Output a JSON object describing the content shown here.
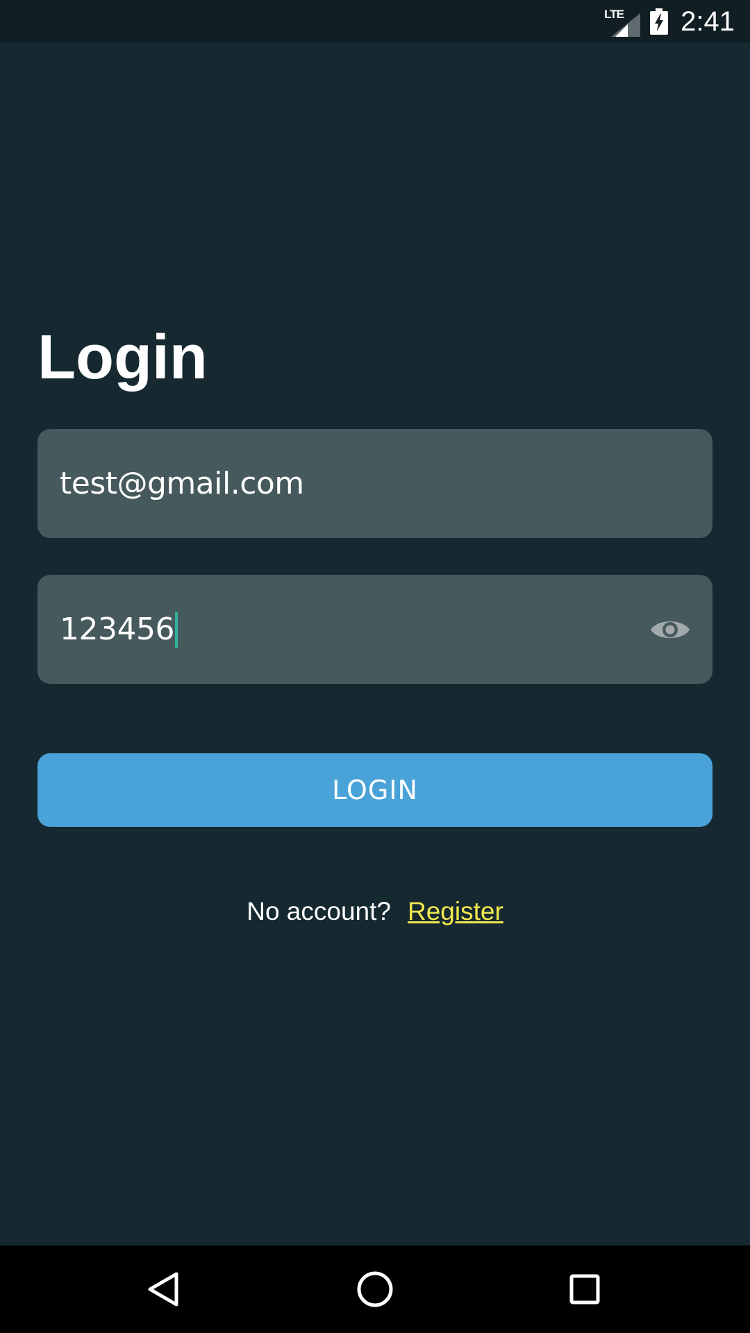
{
  "status_bar": {
    "network": "LTE",
    "time": "2:41",
    "icons": [
      "lte-signal-icon",
      "battery-charging-icon"
    ]
  },
  "login": {
    "title": "Login",
    "email_value": "test@gmail.com",
    "password_value": "123456",
    "password_toggle_icon": "eye-icon",
    "button_label": "LOGIN",
    "no_account_text": "No account?",
    "register_link": "Register"
  },
  "nav_bar": {
    "icons": [
      "back-icon",
      "home-icon",
      "recents-icon"
    ]
  },
  "colors": {
    "background": "#162930",
    "status_bar": "#111f24",
    "field_bg": "#46595d",
    "button": "#4aa3d8",
    "link": "#f2e94e",
    "caret": "#2fb39a"
  }
}
